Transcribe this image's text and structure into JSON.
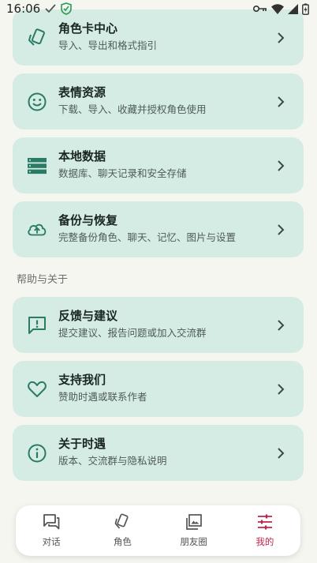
{
  "status_bar": {
    "time": "16:06"
  },
  "cards": [
    {
      "title": "角色卡中心",
      "subtitle": "导入、导出和格式指引",
      "icon": "cards-icon"
    },
    {
      "title": "表情资源",
      "subtitle": "下载、导入、收藏并授权角色使用",
      "icon": "smile-icon"
    },
    {
      "title": "本地数据",
      "subtitle": "数据库、聊天记录和安全存储",
      "icon": "storage-icon"
    },
    {
      "title": "备份与恢复",
      "subtitle": "完整备份角色、聊天、记忆、图片与设置",
      "icon": "cloud-upload-icon"
    },
    {
      "title": "反馈与建议",
      "subtitle": "提交建议、报告问题或加入交流群",
      "icon": "feedback-icon"
    },
    {
      "title": "支持我们",
      "subtitle": "赞助时遇或联系作者",
      "icon": "heart-icon"
    },
    {
      "title": "关于时遇",
      "subtitle": "版本、交流群与隐私说明",
      "icon": "info-icon"
    }
  ],
  "section": {
    "help_label": "帮助与关于"
  },
  "nav": {
    "items": [
      {
        "label": "对话",
        "icon": "chat-icon"
      },
      {
        "label": "角色",
        "icon": "role-icon"
      },
      {
        "label": "朋友圈",
        "icon": "gallery-icon"
      },
      {
        "label": "我的",
        "icon": "settings-sliders-icon"
      }
    ],
    "active_index": 3
  },
  "colors": {
    "accent": "#2a7a66",
    "card_bg": "#d5ece4",
    "active": "#c0244d"
  }
}
